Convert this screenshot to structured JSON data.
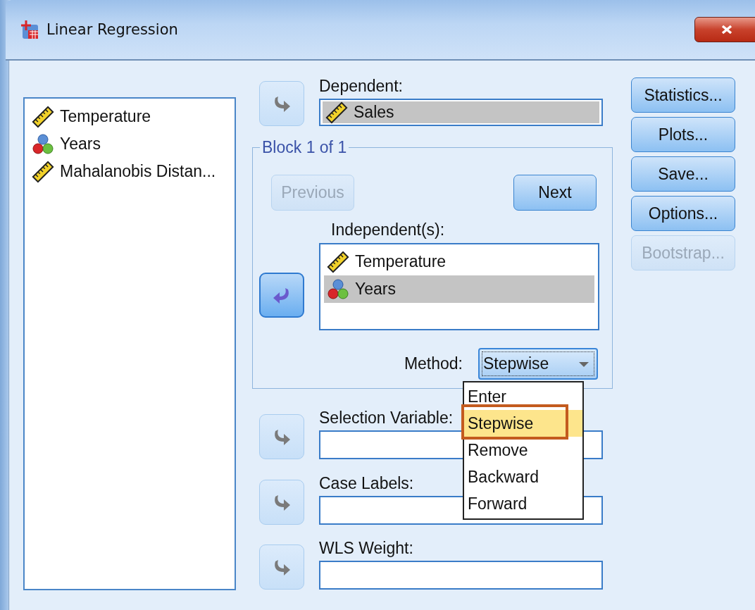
{
  "window": {
    "title": "Linear Regression"
  },
  "source_variables": [
    {
      "name": "Temperature",
      "kind": "scale",
      "selected": false
    },
    {
      "name": "Years",
      "kind": "nominal",
      "selected": false
    },
    {
      "name": "Mahalanobis Distan...",
      "kind": "scale",
      "selected": false
    }
  ],
  "dependent": {
    "label": "Dependent:",
    "arrow": {
      "kind": "right"
    },
    "variables": [
      {
        "name": "Sales",
        "kind": "scale",
        "selected": true
      }
    ]
  },
  "block": {
    "title": "Block 1 of 1",
    "previous": {
      "label": "Previous",
      "disabled": true
    },
    "next": {
      "label": "Next",
      "disabled": false
    },
    "independent": {
      "label": "Independent(s):",
      "arrow": {
        "kind": "left"
      },
      "variables": [
        {
          "name": "Temperature",
          "kind": "scale",
          "selected": false
        },
        {
          "name": "Years",
          "kind": "nominal",
          "selected": true
        }
      ]
    },
    "method": {
      "label": "Method:",
      "value": "Stepwise",
      "expanded": true,
      "options": [
        {
          "label": "Enter",
          "selected": false
        },
        {
          "label": "Stepwise",
          "selected": true
        },
        {
          "label": "Remove",
          "selected": false
        },
        {
          "label": "Backward",
          "selected": false
        },
        {
          "label": "Forward",
          "selected": false
        }
      ]
    }
  },
  "selection_variable": {
    "label": "Selection Variable:",
    "arrow": {
      "kind": "right"
    }
  },
  "case_labels": {
    "label": "Case Labels:",
    "arrow": {
      "kind": "right"
    }
  },
  "wls_weight": {
    "label": "WLS Weight:",
    "arrow": {
      "kind": "right"
    }
  },
  "side_buttons": [
    {
      "label": "Statistics...",
      "disabled": false
    },
    {
      "label": "Plots...",
      "disabled": false
    },
    {
      "label": "Save...",
      "disabled": false
    },
    {
      "label": "Options...",
      "disabled": false
    },
    {
      "label": "Bootstrap...",
      "disabled": true
    }
  ]
}
